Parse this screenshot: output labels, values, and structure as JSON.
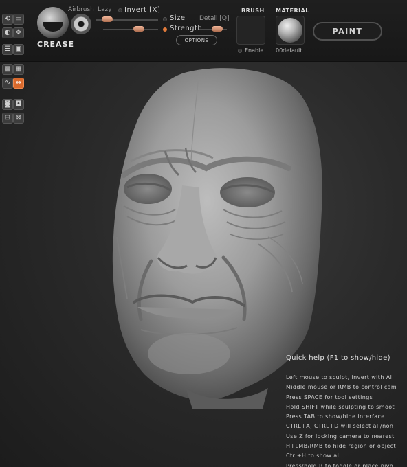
{
  "brush": {
    "name": "CREASE",
    "airbrush_label": "Airbrush",
    "lazy_label": "Lazy",
    "invert_label": "Invert [X]",
    "size_label": "Size",
    "detail_label": "Detail [Q]",
    "strength_label": "Strength",
    "options_label": "OPTIONS"
  },
  "panels": {
    "brush_title": "BRUSH",
    "enable_label": "Enable",
    "material_title": "MATERIAL",
    "material_name": "00default"
  },
  "mode": {
    "paint_label": "PAINT"
  },
  "left_tools": [
    {
      "icon": "rotate-icon",
      "glyph": "⟲"
    },
    {
      "icon": "crop-icon",
      "glyph": "▭"
    },
    {
      "icon": "brush-shape-icon",
      "glyph": "◐"
    },
    {
      "icon": "move-icon",
      "glyph": "✥"
    },
    {
      "icon": "layers-icon",
      "glyph": "☰"
    },
    {
      "icon": "cube-icon",
      "glyph": "▣"
    },
    {
      "icon": "mask-icon",
      "glyph": "▩"
    },
    {
      "icon": "grid-icon",
      "glyph": "▦"
    },
    {
      "icon": "wave-icon",
      "glyph": "∿"
    },
    {
      "icon": "symmetry-icon",
      "glyph": "⇔"
    },
    {
      "icon": "camera-icon",
      "glyph": "◙"
    },
    {
      "icon": "scene-icon",
      "glyph": "◘"
    },
    {
      "icon": "save-icon",
      "glyph": "⊟"
    },
    {
      "icon": "export-icon",
      "glyph": "⊠"
    }
  ],
  "colors": {
    "accent": "#e07a3b",
    "active_tool": "#d9692c",
    "background": "#2a2a2a",
    "model": "#9e9e9e"
  },
  "quick_help": {
    "title": "Quick help (F1 to show/hide)",
    "lines": [
      "Left mouse to sculpt, invert with Al",
      "Middle mouse or RMB to control cam",
      "Press SPACE for tool settings",
      "Hold SHIFT while sculpting to smoot",
      "Press TAB to show/hide interface",
      "CTRL+A, CTRL+D will select all/non",
      "Use Z for locking camera to nearest",
      "H+LMB/RMB to hide region or object",
      "Ctrl+H to show all",
      "Press/hold R to toggle or place pivo"
    ]
  }
}
